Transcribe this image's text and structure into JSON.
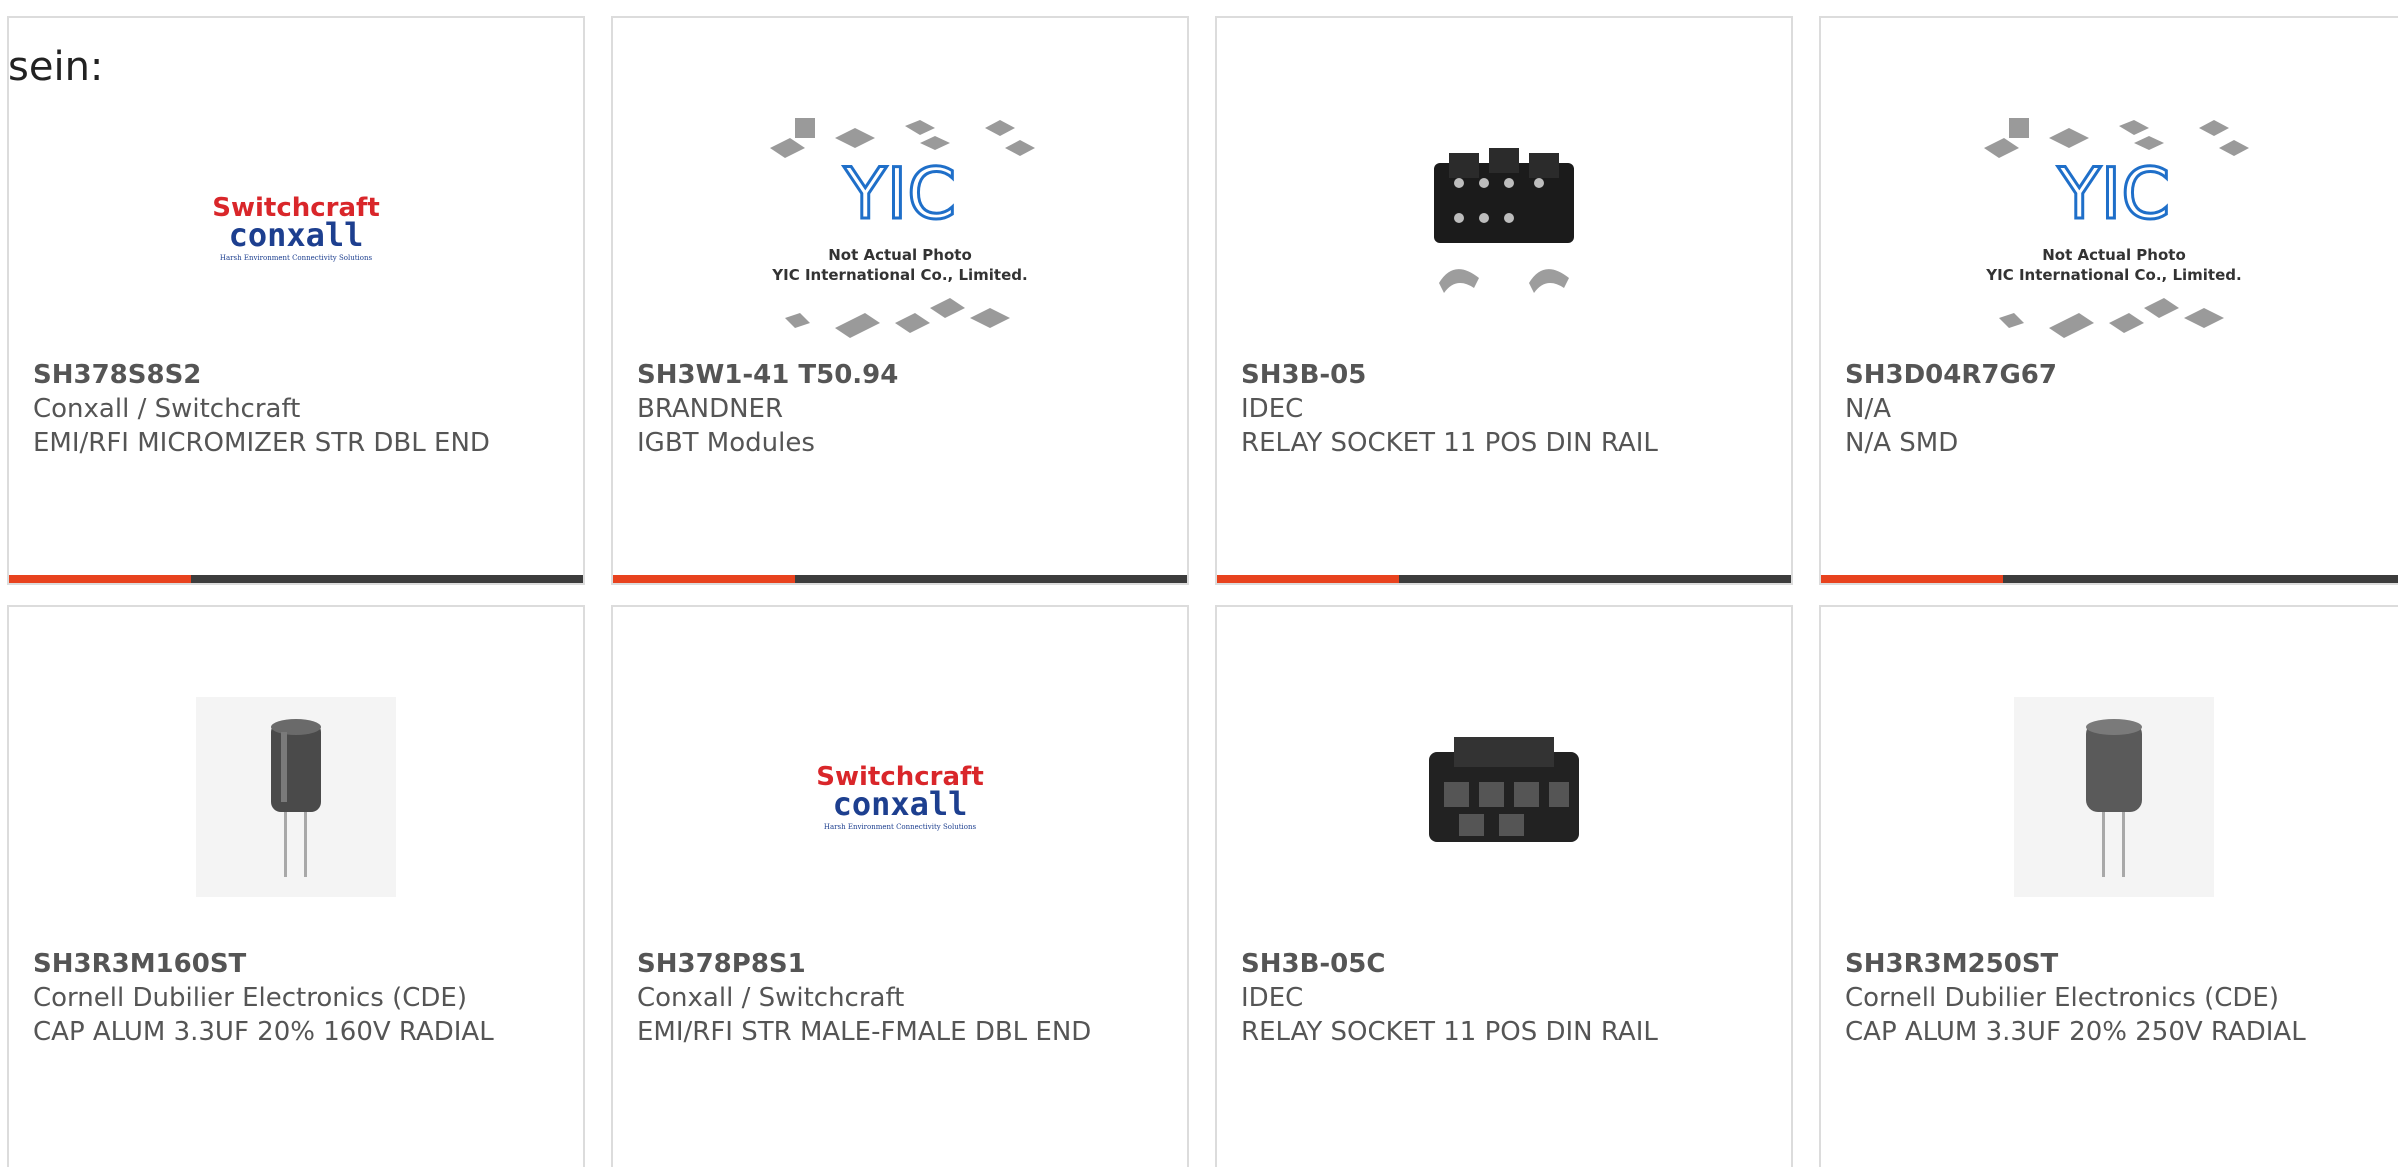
{
  "intro_text": "sein:",
  "colors": {
    "accent": "#e8421e",
    "bar": "#3c3c3c",
    "border": "#dcdcdc",
    "switchcraft_red": "#d9262a",
    "conxall_blue": "#1d3f8f",
    "yic_blue": "#1f6fc9"
  },
  "products": [
    {
      "part_number": "SH378S8S2",
      "manufacturer": "Conxall / Switchcraft",
      "description": "EMI/RFI MICROMIZER STR DBL END",
      "image": "switchcraft-conxall-logo",
      "logo_top": "Switchcraft",
      "logo_bottom": "conxall",
      "logo_tagline": "Harsh Environment Connectivity Solutions"
    },
    {
      "part_number": "SH3W1-41 T50.94",
      "manufacturer": "BRANDNER",
      "description": "IGBT Modules",
      "image": "yic-placeholder",
      "ph_line1": "Not Actual Photo",
      "ph_line2": "YIC International Co., Limited."
    },
    {
      "part_number": "SH3B-05",
      "manufacturer": "IDEC",
      "description": "RELAY SOCKET 11 POS DIN RAIL",
      "image": "relay-socket-with-clips"
    },
    {
      "part_number": "SH3D04R7G67",
      "manufacturer": "N/A",
      "description": "N/A SMD",
      "image": "yic-placeholder",
      "ph_line1": "Not Actual Photo",
      "ph_line2": "YIC International Co., Limited."
    },
    {
      "part_number": "SH3R3M160ST",
      "manufacturer": "Cornell Dubilier Electronics (CDE)",
      "description": "CAP ALUM 3.3UF 20% 160V RADIAL",
      "image": "electrolytic-capacitor"
    },
    {
      "part_number": "SH378P8S1",
      "manufacturer": "Conxall / Switchcraft",
      "description": "EMI/RFI STR MALE-FMALE DBL END",
      "image": "switchcraft-conxall-logo",
      "logo_top": "Switchcraft",
      "logo_bottom": "conxall",
      "logo_tagline": "Harsh Environment Connectivity Solutions"
    },
    {
      "part_number": "SH3B-05C",
      "manufacturer": "IDEC",
      "description": "RELAY SOCKET 11 POS DIN RAIL",
      "image": "relay-socket"
    },
    {
      "part_number": "SH3R3M250ST",
      "manufacturer": "Cornell Dubilier Electronics (CDE)",
      "description": "CAP ALUM 3.3UF 20% 250V RADIAL",
      "image": "electrolytic-capacitor"
    }
  ]
}
